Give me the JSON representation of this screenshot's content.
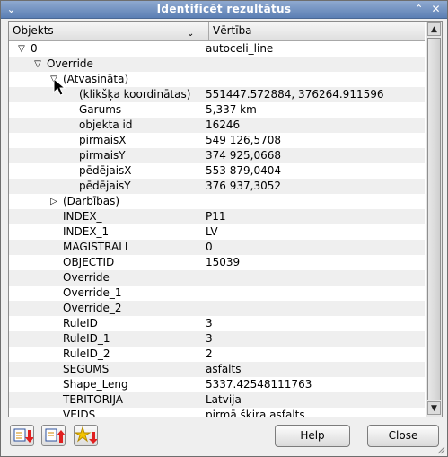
{
  "window": {
    "title": "Identificēt rezultātus"
  },
  "columns": {
    "object": "Objekts",
    "value": "Vērtība"
  },
  "rows": [
    {
      "name": "0",
      "value": "autoceli_line",
      "level": 0,
      "twisty": "open"
    },
    {
      "name": "Override",
      "value": "",
      "level": 1,
      "twisty": "open"
    },
    {
      "name": "(Atvasināta)",
      "value": "",
      "level": 2,
      "twisty": "open"
    },
    {
      "name": "(klikšķa koordinātas)",
      "value": "551447.572884, 376264.911596",
      "level": 3
    },
    {
      "name": "Garums",
      "value": "5,337 km",
      "level": 3
    },
    {
      "name": "objekta id",
      "value": "16246",
      "level": 3
    },
    {
      "name": "pirmaisX",
      "value": "549 126,5708",
      "level": 3
    },
    {
      "name": "pirmaisY",
      "value": "374 925,0668",
      "level": 3
    },
    {
      "name": "pēdējaisX",
      "value": "553 879,0404",
      "level": 3
    },
    {
      "name": "pēdējaisY",
      "value": "376 937,3052",
      "level": 3
    },
    {
      "name": "(Darbības)",
      "value": "",
      "level": 2,
      "twisty": "closed"
    },
    {
      "name": "INDEX_",
      "value": "P11",
      "level": 2
    },
    {
      "name": "INDEX_1",
      "value": "LV",
      "level": 2
    },
    {
      "name": "MAGISTRALI",
      "value": "0",
      "level": 2
    },
    {
      "name": "OBJECTID",
      "value": "15039",
      "level": 2
    },
    {
      "name": "Override",
      "value": "",
      "level": 2
    },
    {
      "name": "Override_1",
      "value": "",
      "level": 2
    },
    {
      "name": "Override_2",
      "value": "",
      "level": 2
    },
    {
      "name": "RuleID",
      "value": "3",
      "level": 2
    },
    {
      "name": "RuleID_1",
      "value": "3",
      "level": 2
    },
    {
      "name": "RuleID_2",
      "value": "2",
      "level": 2
    },
    {
      "name": "SEGUMS",
      "value": "asfalts",
      "level": 2
    },
    {
      "name": "Shape_Leng",
      "value": "5337.42548111763",
      "level": 2
    },
    {
      "name": "TERITORIJA",
      "value": "Latvija",
      "level": 2
    },
    {
      "name": "VEIDS",
      "value": "pirmā šķira asfalts",
      "level": 2
    }
  ],
  "buttons": {
    "help": "Help",
    "close": "Close"
  },
  "icons": {
    "expand_all": "expand-tree-icon",
    "collapse_all": "collapse-tree-icon",
    "expand_new": "star-expand-icon"
  },
  "colors": {
    "titlebar": "#6b8cbf",
    "alt_row": "#efefef"
  }
}
